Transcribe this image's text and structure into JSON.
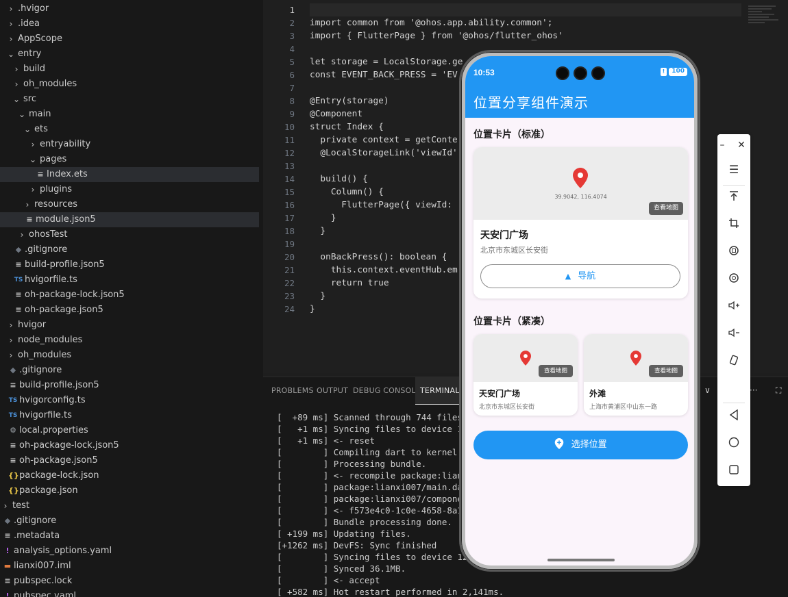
{
  "explorer": {
    "items": [
      {
        "label": ".hvigor",
        "indent": 0,
        "chev": ">",
        "icon": ""
      },
      {
        "label": ".idea",
        "indent": 0,
        "chev": ">",
        "icon": ""
      },
      {
        "label": "AppScope",
        "indent": 0,
        "chev": ">",
        "icon": ""
      },
      {
        "label": "entry",
        "indent": 0,
        "chev": "v",
        "icon": ""
      },
      {
        "label": "build",
        "indent": 1,
        "chev": ">",
        "icon": ""
      },
      {
        "label": "oh_modules",
        "indent": 1,
        "chev": ">",
        "icon": ""
      },
      {
        "label": "src",
        "indent": 1,
        "chev": "v",
        "icon": ""
      },
      {
        "label": "main",
        "indent": 2,
        "chev": "v",
        "icon": ""
      },
      {
        "label": "ets",
        "indent": 3,
        "chev": "v",
        "icon": ""
      },
      {
        "label": "entryability",
        "indent": 4,
        "chev": ">",
        "icon": ""
      },
      {
        "label": "pages",
        "indent": 4,
        "chev": "v",
        "icon": ""
      },
      {
        "label": "Index.ets",
        "indent": 5,
        "chev": "",
        "icon": "≡",
        "selected": true
      },
      {
        "label": "plugins",
        "indent": 4,
        "chev": ">",
        "icon": ""
      },
      {
        "label": "resources",
        "indent": 3,
        "chev": ">",
        "icon": ""
      },
      {
        "label": "module.json5",
        "indent": 3,
        "chev": "",
        "icon": "≡",
        "selected": true
      },
      {
        "label": "ohosTest",
        "indent": 2,
        "chev": ">",
        "icon": ""
      },
      {
        "label": ".gitignore",
        "indent": 1,
        "chev": "",
        "icon": "◆"
      },
      {
        "label": "build-profile.json5",
        "indent": 1,
        "chev": "",
        "icon": "≡"
      },
      {
        "label": "hvigorfile.ts",
        "indent": 1,
        "chev": "",
        "icon": "TS"
      },
      {
        "label": "oh-package-lock.json5",
        "indent": 1,
        "chev": "",
        "icon": "≡"
      },
      {
        "label": "oh-package.json5",
        "indent": 1,
        "chev": "",
        "icon": "≡"
      },
      {
        "label": "hvigor",
        "indent": 0,
        "chev": ">",
        "icon": ""
      },
      {
        "label": "node_modules",
        "indent": 0,
        "chev": ">",
        "icon": ""
      },
      {
        "label": "oh_modules",
        "indent": 0,
        "chev": ">",
        "icon": ""
      },
      {
        "label": ".gitignore",
        "indent": 0,
        "chev": "",
        "icon": "◆"
      },
      {
        "label": "build-profile.json5",
        "indent": 0,
        "chev": "",
        "icon": "≡"
      },
      {
        "label": "hvigorconfig.ts",
        "indent": 0,
        "chev": "",
        "icon": "TS"
      },
      {
        "label": "hvigorfile.ts",
        "indent": 0,
        "chev": "",
        "icon": "TS"
      },
      {
        "label": "local.properties",
        "indent": 0,
        "chev": "",
        "icon": "⚙"
      },
      {
        "label": "oh-package-lock.json5",
        "indent": 0,
        "chev": "",
        "icon": "≡"
      },
      {
        "label": "oh-package.json5",
        "indent": 0,
        "chev": "",
        "icon": "≡"
      },
      {
        "label": "package-lock.json",
        "indent": 0,
        "chev": "",
        "icon": "{}"
      },
      {
        "label": "package.json",
        "indent": 0,
        "chev": "",
        "icon": "{}"
      },
      {
        "label": "test",
        "indent": -1,
        "chev": ">",
        "icon": ""
      },
      {
        "label": ".gitignore",
        "indent": -1,
        "chev": "",
        "icon": "◆"
      },
      {
        "label": ".metadata",
        "indent": -1,
        "chev": "",
        "icon": "≡"
      },
      {
        "label": "analysis_options.yaml",
        "indent": -1,
        "chev": "",
        "icon": "!"
      },
      {
        "label": "lianxi007.iml",
        "indent": -1,
        "chev": "",
        "icon": "▬"
      },
      {
        "label": "pubspec.lock",
        "indent": -1,
        "chev": "",
        "icon": "≡"
      },
      {
        "label": "pubspec.yaml",
        "indent": -1,
        "chev": "",
        "icon": "!"
      }
    ]
  },
  "editor": {
    "lines": [
      {
        "n": "1",
        "code": ""
      },
      {
        "n": "2",
        "code": "import common from '@ohos.app.ability.common';"
      },
      {
        "n": "3",
        "code": "import { FlutterPage } from '@ohos/flutter_ohos'"
      },
      {
        "n": "4",
        "code": ""
      },
      {
        "n": "5",
        "code": "let storage = LocalStorage.ge"
      },
      {
        "n": "6",
        "code": "const EVENT_BACK_PRESS = 'EV"
      },
      {
        "n": "7",
        "code": ""
      },
      {
        "n": "8",
        "code": "@Entry(storage)"
      },
      {
        "n": "9",
        "code": "@Component"
      },
      {
        "n": "10",
        "code": "struct Index {"
      },
      {
        "n": "11",
        "code": "  private context = getConte"
      },
      {
        "n": "12",
        "code": "  @LocalStorageLink('viewId'"
      },
      {
        "n": "13",
        "code": ""
      },
      {
        "n": "14",
        "code": "  build() {"
      },
      {
        "n": "15",
        "code": "    Column() {"
      },
      {
        "n": "16",
        "code": "      FlutterPage({ viewId: "
      },
      {
        "n": "17",
        "code": "    }"
      },
      {
        "n": "18",
        "code": "  }"
      },
      {
        "n": "19",
        "code": ""
      },
      {
        "n": "20",
        "code": "  onBackPress(): boolean {"
      },
      {
        "n": "21",
        "code": "    this.context.eventHub.em"
      },
      {
        "n": "22",
        "code": "    return true"
      },
      {
        "n": "23",
        "code": "  }"
      },
      {
        "n": "24",
        "code": "}"
      }
    ]
  },
  "panel": {
    "tabs": [
      "PROBLEMS",
      "OUTPUT",
      "DEBUG CONSOLE",
      "TERMINAL"
    ],
    "controls": [
      "∨",
      "···",
      "⛶"
    ],
    "terminal": [
      "[  +89 ms] Scanned through 744 files i",
      "[   +1 ms] Syncing files to device 127",
      "[   +1 ms] <- reset",
      "[        ] Compiling dart to kernel wi",
      "[        ] Processing bundle.",
      "[        ] <- recompile package:lianxi",
      "[        ] package:lianxi007/main.dart",
      "[        ] package:lianxi007/component",
      "[        ] <- f573e4c0-1c0e-4658-8a11-",
      "[        ] Bundle processing done.",
      "[ +199 ms] Updating files.",
      "[+1262 ms] DevFS: Sync finished",
      "[        ] Syncing files to device 127.",
      "[        ] Synced 36.1MB.",
      "[        ] <- accept",
      "[ +582 ms] Hot restart performed in 2,141ms."
    ]
  },
  "phone": {
    "time": "10:53",
    "battery": "100",
    "sim": "!",
    "title": "位置分享组件演示",
    "section1": "位置卡片（标准）",
    "card1": {
      "coords": "39.9042, 116.4074",
      "view_map": "查看地图",
      "name": "天安门广场",
      "address": "北京市东城区长安街",
      "nav_label": "导航"
    },
    "section2": "位置卡片（紧凑）",
    "compact": [
      {
        "name": "天安门广场",
        "address": "北京市东城区长安街",
        "view_map": "查看地图"
      },
      {
        "name": "外滩",
        "address": "上海市黄浦区中山东一路",
        "view_map": "查看地图"
      }
    ],
    "select_label": "选择位置",
    "accent": "#2196f3",
    "pin_color": "#e53935"
  },
  "devtool": {
    "buttons": [
      "minimize-icon",
      "close-icon",
      "menu-icon",
      "pin-top-icon",
      "crop-icon",
      "rotate-left-icon",
      "rotate-right-icon",
      "volume-up-icon",
      "volume-down-icon",
      "shake-icon",
      "back-icon",
      "home-icon",
      "recents-icon"
    ]
  }
}
